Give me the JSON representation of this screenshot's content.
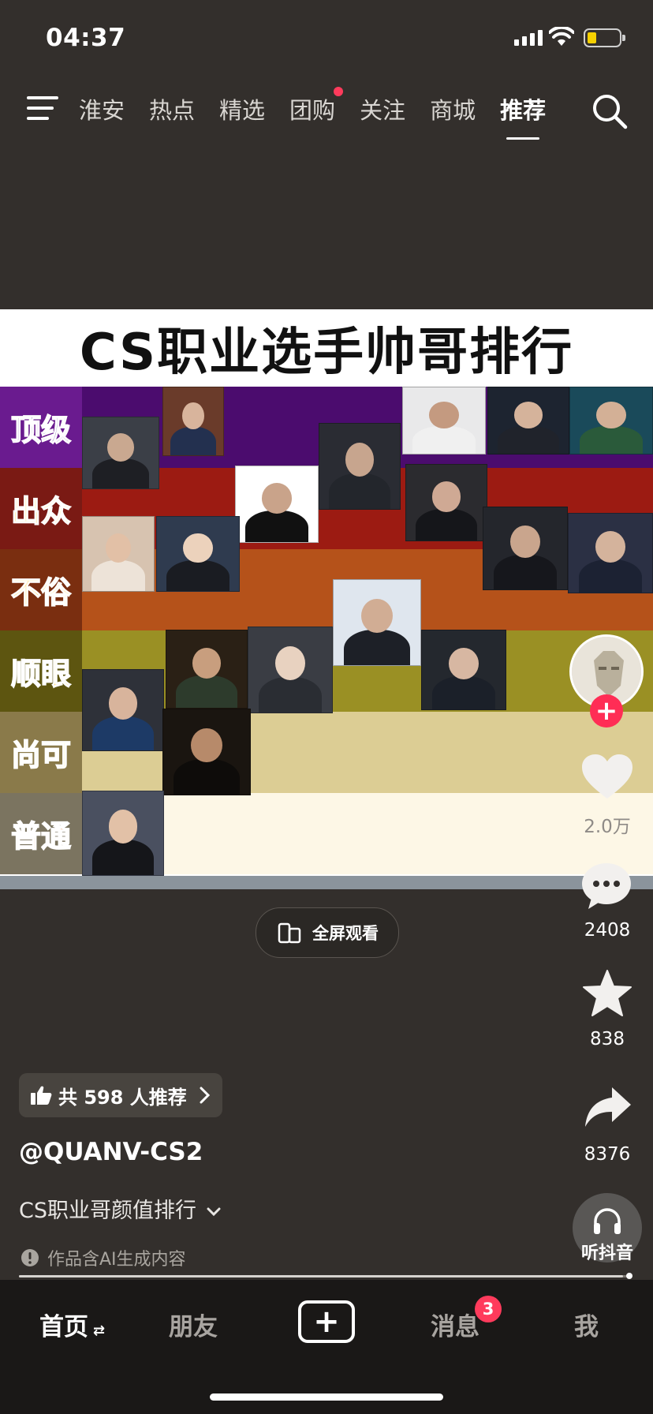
{
  "status_bar": {
    "time": "04:37",
    "battery_level": 0.2
  },
  "top_nav": {
    "tabs": [
      {
        "label": "淮安",
        "active": false,
        "dot": false
      },
      {
        "label": "热点",
        "active": false,
        "dot": false
      },
      {
        "label": "精选",
        "active": false,
        "dot": false
      },
      {
        "label": "团购",
        "active": false,
        "dot": true
      },
      {
        "label": "关注",
        "active": false,
        "dot": false
      },
      {
        "label": "商城",
        "active": false,
        "dot": false
      },
      {
        "label": "推荐",
        "active": true,
        "dot": false
      }
    ]
  },
  "video": {
    "title": "CS职业选手帅哥排行",
    "tiers": [
      {
        "label": "顶级",
        "label_color": "#4a2a8c",
        "label_bg": "#6a1b8f",
        "row_color": "#4b0c6e"
      },
      {
        "label": "出众",
        "label_color": "#ffdd55",
        "label_bg": "#7a1a14",
        "row_color": "#9c1b12"
      },
      {
        "label": "不俗",
        "label_color": "#ffcc33",
        "label_bg": "#7a2e10",
        "row_color": "#b5521a"
      },
      {
        "label": "顺眼",
        "label_color": "#ffcc33",
        "label_bg": "#5d5510",
        "row_color": "#9a9024"
      },
      {
        "label": "尚可",
        "label_color": "#fff2a0",
        "label_bg": "#8a7a4a",
        "row_color": "#dccd94"
      },
      {
        "label": "普通",
        "label_color": "#f6d7c0",
        "label_bg": "#7b7460",
        "row_color": "#fdf7e6"
      }
    ]
  },
  "fullscreen_label": "全屏观看",
  "right_rail": {
    "likes": "2.0万",
    "comments": "2408",
    "favorites": "838",
    "shares": "8376",
    "listen_label": "听抖音"
  },
  "info": {
    "recommend": "共 598 人推荐",
    "author": "@QUANV-CS2",
    "caption": "CS职业哥颜值排行",
    "ai_note": "作品含AI生成内容",
    "progress": 0.99
  },
  "bottom_nav": {
    "home": "首页",
    "friends": "朋友",
    "messages": "消息",
    "messages_badge": "3",
    "me": "我"
  }
}
